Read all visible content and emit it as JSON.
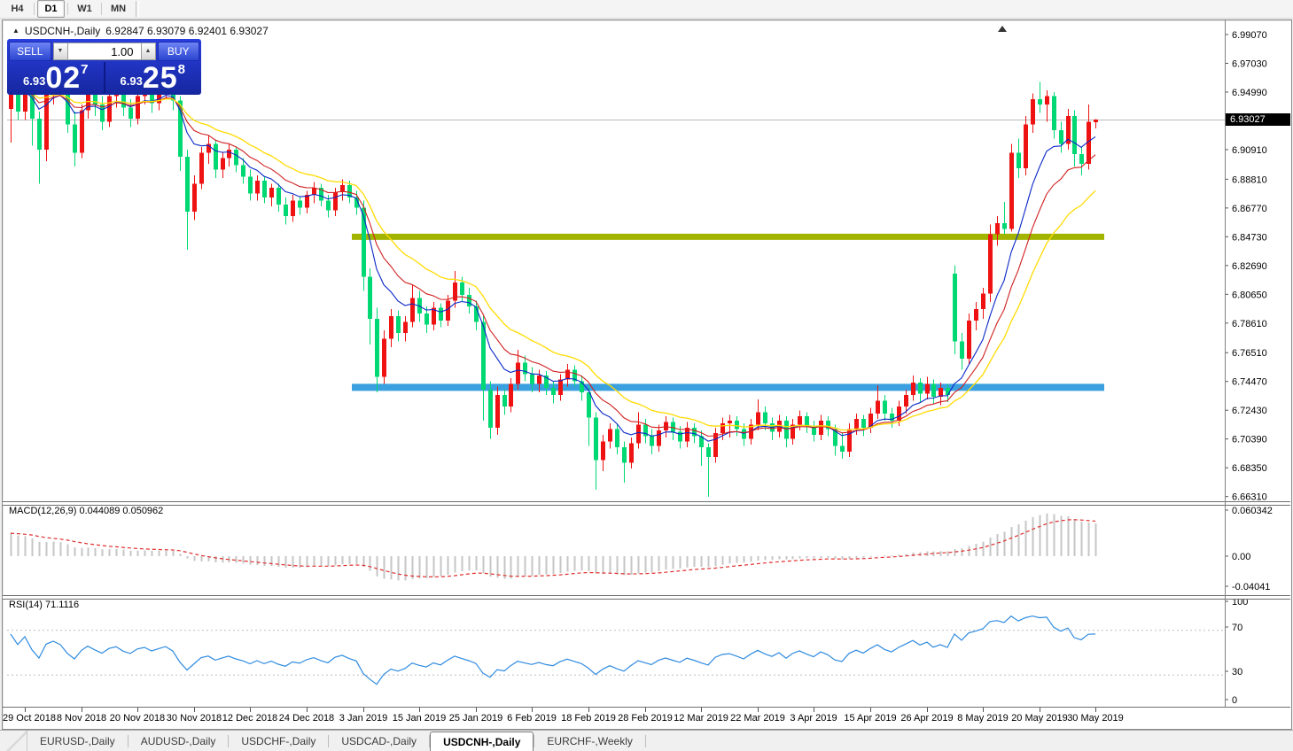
{
  "toolbar": {
    "timeframes": [
      {
        "label": "H4",
        "active": false
      },
      {
        "label": "D1",
        "active": true
      },
      {
        "label": "W1",
        "active": false
      },
      {
        "label": "MN",
        "active": false
      }
    ]
  },
  "chart_header": {
    "collapse_icon": "▲",
    "symbol": "USDCNH-,Daily",
    "ohlc_text": "6.92847 6.93079 6.92401 6.93027"
  },
  "trade_panel": {
    "sell_label": "SELL",
    "buy_label": "BUY",
    "volume": "1.00",
    "spin_down_icon": "▼",
    "spin_up_icon": "▲",
    "sell_price_small": "6.93",
    "sell_price_big": "02",
    "sell_price_sup": "7",
    "buy_price_small": "6.93",
    "buy_price_big": "25",
    "buy_price_sup": "8"
  },
  "price_axis": {
    "current_tag": "6.93027",
    "labels": [
      "6.99070",
      "6.97030",
      "6.94990",
      "6.90910",
      "6.88810",
      "6.86770",
      "6.84730",
      "6.82690",
      "6.80650",
      "6.78610",
      "6.76510",
      "6.74470",
      "6.72430",
      "6.70390",
      "6.68350",
      "6.66310"
    ]
  },
  "macd_panel": {
    "label": "MACD(12,26,9) 0.044089 0.050962",
    "axis_labels": [
      "0.060342",
      "0.00",
      "-0.04041"
    ]
  },
  "rsi_panel": {
    "label": "RSI(14) 71.1116",
    "axis_labels": [
      "100",
      "70",
      "30",
      "0"
    ]
  },
  "date_axis": [
    "29 Oct 2018",
    "8 Nov 2018",
    "20 Nov 2018",
    "30 Nov 2018",
    "12 Dec 2018",
    "24 Dec 2018",
    "3 Jan 2019",
    "15 Jan 2019",
    "25 Jan 2019",
    "6 Feb 2019",
    "18 Feb 2019",
    "28 Feb 2019",
    "12 Mar 2019",
    "22 Mar 2019",
    "3 Apr 2019",
    "15 Apr 2019",
    "26 Apr 2019",
    "8 May 2019",
    "20 May 2019",
    "30 May 2019"
  ],
  "tabs": [
    {
      "label": "EURUSD-,Daily",
      "active": false
    },
    {
      "label": "AUDUSD-,Daily",
      "active": false
    },
    {
      "label": "USDCHF-,Daily",
      "active": false
    },
    {
      "label": "USDCAD-,Daily",
      "active": false
    },
    {
      "label": "USDCNH-,Daily",
      "active": true
    },
    {
      "label": "EURCHF-,Weekly",
      "active": false
    }
  ],
  "colors": {
    "bull_candle": "#ef1212",
    "bear_candle": "#00d873",
    "ma_blue": "#0a28c8",
    "ma_red": "#d02020",
    "ma_yellow": "#ffdb00",
    "hline_olive": "#a2b400",
    "hline_blue": "#3aa0e0",
    "macd_hist": "#c6c6c6",
    "macd_signal": "#e03030",
    "rsi_line": "#2f8be0",
    "dashed_level": "#bdbdbd",
    "bid_line": "#bbbbbb",
    "tag_bg": "#000000"
  },
  "chart_data": {
    "type": "candlestick+indicators",
    "symbol": "USDCNH",
    "timeframe": "Daily",
    "title_ohlc": {
      "open": 6.92847,
      "high": 6.93079,
      "low": 6.92401,
      "close": 6.93027
    },
    "current_price": 6.93027,
    "price_axis_ticks": [
      6.9907,
      6.9703,
      6.9499,
      6.9091,
      6.8881,
      6.8677,
      6.8473,
      6.8269,
      6.8065,
      6.7861,
      6.7651,
      6.7447,
      6.7243,
      6.7039,
      6.6835,
      6.6631
    ],
    "price_range": {
      "max": 6.99761,
      "min": 6.65975
    },
    "horizontal_lines": [
      {
        "price": 6.8473,
        "color_key": "hline_olive",
        "thickness": 7
      },
      {
        "price": 6.7405,
        "color_key": "hline_blue",
        "thickness": 8
      }
    ],
    "moving_averages": [
      {
        "period": 8,
        "color_key": "ma_blue"
      },
      {
        "period": 13,
        "color_key": "ma_red"
      },
      {
        "period": 21,
        "color_key": "ma_yellow"
      }
    ],
    "macd": {
      "fast": 12,
      "slow": 26,
      "signal": 9,
      "main_value": 0.044089,
      "signal_value": 0.050962,
      "axis_max": 0.060342,
      "axis_min": -0.04041
    },
    "rsi": {
      "period": 14,
      "value": 71.1116,
      "levels": [
        70,
        30
      ]
    },
    "tick_label_every": 8,
    "first_tick_candle_index": 2,
    "candle_format": "[open,high,low,close]",
    "candles": [
      [
        6.938,
        6.958,
        6.914,
        6.952
      ],
      [
        6.952,
        6.96,
        6.93,
        6.936
      ],
      [
        6.936,
        6.962,
        6.93,
        6.957
      ],
      [
        6.957,
        6.961,
        6.912,
        6.931
      ],
      [
        6.931,
        6.936,
        6.885,
        6.909
      ],
      [
        6.909,
        6.956,
        6.901,
        6.951
      ],
      [
        6.951,
        6.969,
        6.941,
        6.963
      ],
      [
        6.963,
        6.973,
        6.949,
        6.954
      ],
      [
        6.954,
        6.959,
        6.921,
        6.927
      ],
      [
        6.927,
        6.936,
        6.897,
        6.907
      ],
      [
        6.907,
        6.941,
        6.903,
        6.937
      ],
      [
        6.937,
        6.963,
        6.931,
        6.954
      ],
      [
        6.954,
        6.959,
        6.933,
        6.941
      ],
      [
        6.941,
        6.947,
        6.923,
        6.929
      ],
      [
        6.929,
        6.951,
        6.925,
        6.947
      ],
      [
        6.947,
        6.959,
        6.939,
        6.954
      ],
      [
        6.954,
        6.957,
        6.933,
        6.939
      ],
      [
        6.939,
        6.945,
        6.925,
        6.931
      ],
      [
        6.931,
        6.951,
        6.927,
        6.947
      ],
      [
        6.947,
        6.957,
        6.941,
        6.953
      ],
      [
        6.953,
        6.956,
        6.935,
        6.942
      ],
      [
        6.942,
        6.953,
        6.937,
        6.95
      ],
      [
        6.95,
        6.964,
        6.945,
        6.957
      ],
      [
        6.957,
        6.959,
        6.937,
        6.944
      ],
      [
        6.944,
        6.947,
        6.894,
        6.904
      ],
      [
        6.904,
        6.909,
        6.838,
        6.865
      ],
      [
        6.865,
        6.891,
        6.859,
        6.885
      ],
      [
        6.885,
        6.911,
        6.881,
        6.907
      ],
      [
        6.907,
        6.919,
        6.899,
        6.913
      ],
      [
        6.913,
        6.916,
        6.889,
        6.895
      ],
      [
        6.895,
        6.907,
        6.889,
        6.903
      ],
      [
        6.903,
        6.913,
        6.897,
        6.909
      ],
      [
        6.909,
        6.911,
        6.893,
        6.898
      ],
      [
        6.898,
        6.903,
        6.885,
        6.89
      ],
      [
        6.89,
        6.895,
        6.873,
        6.878
      ],
      [
        6.878,
        6.891,
        6.873,
        6.887
      ],
      [
        6.887,
        6.89,
        6.871,
        6.875
      ],
      [
        6.875,
        6.885,
        6.869,
        6.882
      ],
      [
        6.882,
        6.885,
        6.865,
        6.87
      ],
      [
        6.87,
        6.875,
        6.856,
        6.862
      ],
      [
        6.862,
        6.877,
        6.858,
        6.873
      ],
      [
        6.873,
        6.876,
        6.863,
        6.868
      ],
      [
        6.868,
        6.88,
        6.864,
        6.877
      ],
      [
        6.877,
        6.886,
        6.871,
        6.882
      ],
      [
        6.882,
        6.885,
        6.869,
        6.873
      ],
      [
        6.873,
        6.877,
        6.861,
        6.866
      ],
      [
        6.866,
        6.882,
        6.862,
        6.879
      ],
      [
        6.879,
        6.888,
        6.873,
        6.884
      ],
      [
        6.884,
        6.887,
        6.871,
        6.875
      ],
      [
        6.875,
        6.88,
        6.863,
        6.868
      ],
      [
        6.868,
        6.873,
        6.809,
        6.819
      ],
      [
        6.819,
        6.825,
        6.771,
        6.789
      ],
      [
        6.789,
        6.797,
        6.737,
        6.748
      ],
      [
        6.748,
        6.781,
        6.743,
        6.775
      ],
      [
        6.775,
        6.796,
        6.769,
        6.791
      ],
      [
        6.791,
        6.795,
        6.773,
        6.779
      ],
      [
        6.779,
        6.791,
        6.773,
        6.787
      ],
      [
        6.787,
        6.813,
        6.783,
        6.804
      ],
      [
        6.804,
        6.809,
        6.787,
        6.793
      ],
      [
        6.793,
        6.798,
        6.779,
        6.785
      ],
      [
        6.785,
        6.801,
        6.781,
        6.797
      ],
      [
        6.797,
        6.8,
        6.783,
        6.788
      ],
      [
        6.788,
        6.806,
        6.784,
        6.802
      ],
      [
        6.802,
        6.823,
        6.797,
        6.815
      ],
      [
        6.815,
        6.819,
        6.801,
        6.806
      ],
      [
        6.806,
        6.811,
        6.793,
        6.798
      ],
      [
        6.798,
        6.802,
        6.781,
        6.787
      ],
      [
        6.787,
        6.791,
        6.717,
        6.739
      ],
      [
        6.739,
        6.745,
        6.704,
        6.712
      ],
      [
        6.712,
        6.741,
        6.707,
        6.735
      ],
      [
        6.735,
        6.739,
        6.721,
        6.727
      ],
      [
        6.727,
        6.747,
        6.723,
        6.743
      ],
      [
        6.743,
        6.767,
        6.739,
        6.758
      ],
      [
        6.758,
        6.763,
        6.745,
        6.75
      ],
      [
        6.75,
        6.755,
        6.737,
        6.743
      ],
      [
        6.743,
        6.753,
        6.737,
        6.749
      ],
      [
        6.749,
        6.752,
        6.735,
        6.74
      ],
      [
        6.74,
        6.745,
        6.729,
        6.735
      ],
      [
        6.735,
        6.75,
        6.731,
        6.746
      ],
      [
        6.746,
        6.757,
        6.741,
        6.753
      ],
      [
        6.753,
        6.756,
        6.741,
        6.745
      ],
      [
        6.745,
        6.749,
        6.731,
        6.737
      ],
      [
        6.737,
        6.741,
        6.699,
        6.719
      ],
      [
        6.719,
        6.723,
        6.668,
        6.689
      ],
      [
        6.689,
        6.707,
        6.681,
        6.702
      ],
      [
        6.702,
        6.715,
        6.697,
        6.711
      ],
      [
        6.711,
        6.714,
        6.693,
        6.698
      ],
      [
        6.698,
        6.702,
        6.673,
        6.687
      ],
      [
        6.687,
        6.705,
        6.683,
        6.701
      ],
      [
        6.701,
        6.723,
        6.697,
        6.714
      ],
      [
        6.714,
        6.718,
        6.701,
        6.706
      ],
      [
        6.706,
        6.711,
        6.693,
        6.699
      ],
      [
        6.699,
        6.714,
        6.695,
        6.71
      ],
      [
        6.71,
        6.72,
        6.705,
        6.716
      ],
      [
        6.716,
        6.719,
        6.703,
        6.709
      ],
      [
        6.709,
        6.713,
        6.697,
        6.702
      ],
      [
        6.702,
        6.716,
        6.698,
        6.712
      ],
      [
        6.712,
        6.715,
        6.701,
        6.706
      ],
      [
        6.706,
        6.71,
        6.685,
        6.698
      ],
      [
        6.698,
        6.701,
        6.663,
        6.691
      ],
      [
        6.691,
        6.712,
        6.687,
        6.708
      ],
      [
        6.708,
        6.719,
        6.703,
        6.715
      ],
      [
        6.715,
        6.721,
        6.705,
        6.717
      ],
      [
        6.717,
        6.72,
        6.706,
        6.711
      ],
      [
        6.711,
        6.715,
        6.699,
        6.704
      ],
      [
        6.704,
        6.718,
        6.7,
        6.714
      ],
      [
        6.714,
        6.732,
        6.71,
        6.723
      ],
      [
        6.723,
        6.727,
        6.71,
        6.715
      ],
      [
        6.715,
        6.719,
        6.703,
        6.709
      ],
      [
        6.709,
        6.721,
        6.705,
        6.717
      ],
      [
        6.717,
        6.72,
        6.698,
        6.704
      ],
      [
        6.704,
        6.718,
        6.7,
        6.714
      ],
      [
        6.714,
        6.724,
        6.71,
        6.72
      ],
      [
        6.72,
        6.723,
        6.708,
        6.713
      ],
      [
        6.713,
        6.717,
        6.702,
        6.707
      ],
      [
        6.707,
        6.721,
        6.703,
        6.717
      ],
      [
        6.717,
        6.72,
        6.706,
        6.711
      ],
      [
        6.711,
        6.714,
        6.692,
        6.699
      ],
      [
        6.699,
        6.708,
        6.69,
        6.695
      ],
      [
        6.695,
        6.715,
        6.691,
        6.711
      ],
      [
        6.711,
        6.722,
        6.707,
        6.718
      ],
      [
        6.718,
        6.721,
        6.706,
        6.712
      ],
      [
        6.712,
        6.726,
        6.708,
        6.722
      ],
      [
        6.722,
        6.742,
        6.718,
        6.731
      ],
      [
        6.731,
        6.735,
        6.717,
        6.722
      ],
      [
        6.722,
        6.726,
        6.712,
        6.717
      ],
      [
        6.717,
        6.731,
        6.713,
        6.727
      ],
      [
        6.727,
        6.739,
        6.722,
        6.735
      ],
      [
        6.735,
        6.749,
        6.731,
        6.744
      ],
      [
        6.744,
        6.747,
        6.73,
        6.736
      ],
      [
        6.736,
        6.748,
        6.732,
        6.743
      ],
      [
        6.743,
        6.746,
        6.729,
        6.734
      ],
      [
        6.734,
        6.744,
        6.728,
        6.74
      ],
      [
        6.74,
        6.743,
        6.73,
        6.735
      ],
      [
        6.821,
        6.827,
        6.764,
        6.773
      ],
      [
        6.773,
        6.779,
        6.753,
        6.761
      ],
      [
        6.761,
        6.793,
        6.757,
        6.788
      ],
      [
        6.788,
        6.801,
        6.781,
        6.796
      ],
      [
        6.796,
        6.811,
        6.789,
        6.807
      ],
      [
        6.807,
        6.856,
        6.801,
        6.849
      ],
      [
        6.849,
        6.862,
        6.841,
        6.857
      ],
      [
        6.857,
        6.872,
        6.849,
        6.853
      ],
      [
        6.853,
        6.913,
        6.851,
        6.907
      ],
      [
        6.907,
        6.917,
        6.889,
        6.896
      ],
      [
        6.896,
        6.933,
        6.891,
        6.927
      ],
      [
        6.927,
        6.949,
        6.921,
        6.945
      ],
      [
        6.945,
        6.957,
        6.935,
        6.941
      ],
      [
        6.941,
        6.951,
        6.929,
        6.947
      ],
      [
        6.947,
        6.95,
        6.917,
        6.923
      ],
      [
        6.923,
        6.929,
        6.907,
        6.913
      ],
      [
        6.913,
        6.938,
        6.909,
        6.933
      ],
      [
        6.933,
        6.937,
        6.897,
        6.906
      ],
      [
        6.906,
        6.911,
        6.891,
        6.899
      ],
      [
        6.899,
        6.941,
        6.895,
        6.929
      ],
      [
        6.92847,
        6.93079,
        6.92401,
        6.93027
      ]
    ]
  }
}
